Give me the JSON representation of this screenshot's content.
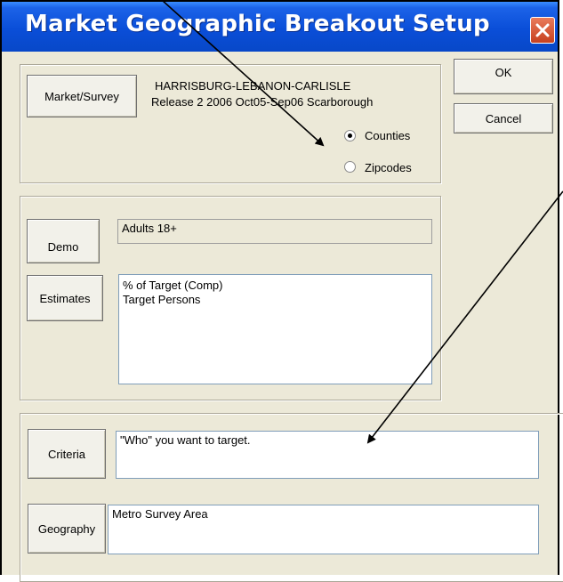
{
  "window": {
    "title": "Market Geographic Breakout Setup",
    "close_icon": "close-icon"
  },
  "market": {
    "button_label": "Market/Survey",
    "name": "HARRISBURG-LEBANON-CARLISLE",
    "release": "Release 2 2006 Oct05-Sep06 Scarborough",
    "options": [
      {
        "label": "Counties",
        "selected": true
      },
      {
        "label": "Zipcodes",
        "selected": false
      }
    ]
  },
  "actions": {
    "ok_label": "OK",
    "cancel_label": "Cancel"
  },
  "demo": {
    "button_label": "Demo",
    "value": "Adults 18+"
  },
  "estimates": {
    "button_label": "Estimates",
    "items": [
      "% of Target (Comp)",
      "Target Persons"
    ]
  },
  "criteria": {
    "button_label": "Criteria",
    "value": "\"Who\" you want to target."
  },
  "geography": {
    "button_label": "Geography",
    "value": "Metro Survey Area"
  },
  "colors": {
    "title_bar": "#0A4ED8",
    "dialog_bg": "#ECE9D8",
    "close_button": "#D4532F"
  }
}
